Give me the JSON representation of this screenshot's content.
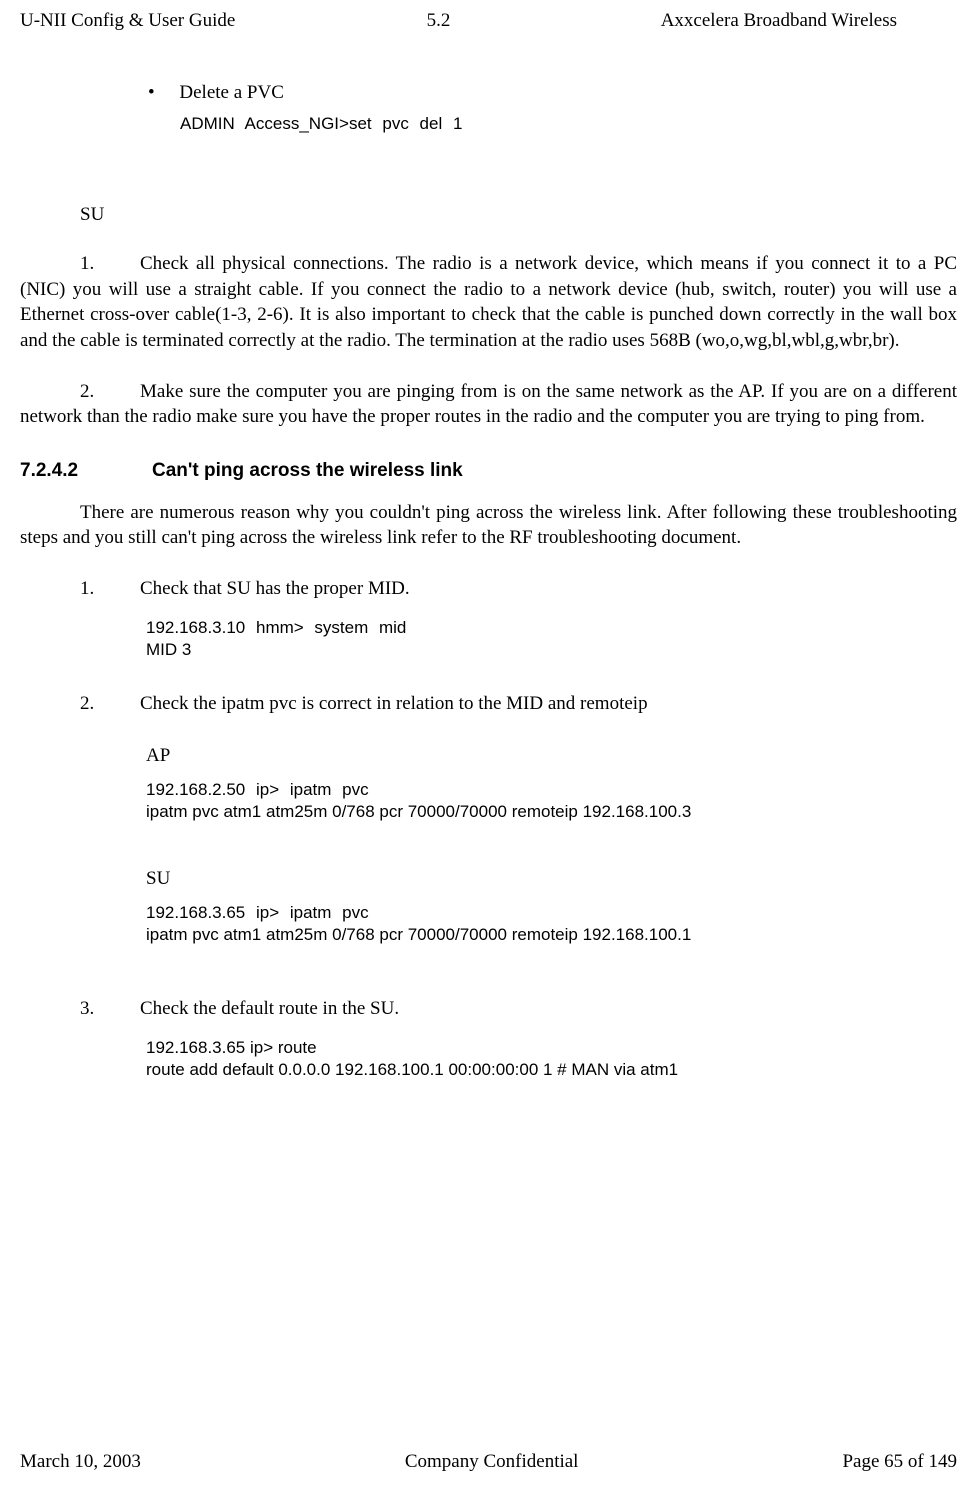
{
  "header": {
    "left": "U-NII Config & User Guide",
    "mid": "5.2",
    "right": "Axxcelera Broadband Wireless"
  },
  "bullet1": {
    "label": "Delete a PVC",
    "code": "ADMIN Access_NGI>set  pvc  del  1"
  },
  "su_label": "SU",
  "para1": {
    "num": "1.",
    "text": "Check all physical connections. The radio is a network device, which means if you connect it to a PC (NIC) you will use a straight cable. If you  connect the radio to a network device (hub, switch, router) you will use a Ethernet cross-over cable(1-3, 2-6). It is also important to check that the cable is punched down correctly in the wall box and the cable is terminated correctly at the radio. The termination at the radio uses 568B (wo,o,wg,bl,wbl,g,wbr,br)."
  },
  "para2": {
    "num": "2.",
    "text": "Make sure the computer you are pinging from is on the same network as the AP. If you are on a different network than the radio make sure you have the proper routes in the radio and the computer you are trying to ping from."
  },
  "section": {
    "num": "7.2.4.2",
    "title": "Can't ping across the wireless link"
  },
  "intro": "There are numerous reason why you couldn't ping across the wireless link. After following these troubleshooting steps and you still can't ping across the wireless link refer to the RF troubleshooting document.",
  "step1": {
    "num": "1.",
    "text": "Check that SU has the proper MID.",
    "code1": "192.168.3.10 hmm>  system  mid",
    "code2": "MID 3"
  },
  "step2": {
    "num": "2.",
    "text": "Check the ipatm pvc is correct in relation to the MID and remoteip",
    "ap_label": "AP",
    "ap_code1": "192.168.2.50 ip>  ipatm  pvc",
    "ap_code2": "ipatm pvc atm1 atm25m 0/768 pcr 70000/70000 remoteip 192.168.100.3",
    "su_label": "SU",
    "su_code1": "192.168.3.65 ip>  ipatm  pvc",
    "su_code2": "ipatm pvc atm1 atm25m 0/768 pcr 70000/70000 remoteip 192.168.100.1"
  },
  "step3": {
    "num": "3.",
    "text": "Check the default route in the SU.",
    "code1": "192.168.3.65 ip> route",
    "code2": "route add default         0.0.0.0 192.168.100.1 00:00:00:00 1 # MAN via atm1"
  },
  "footer": {
    "left": "March 10, 2003",
    "mid": "Company Confidential",
    "right": "Page 65 of 149"
  }
}
